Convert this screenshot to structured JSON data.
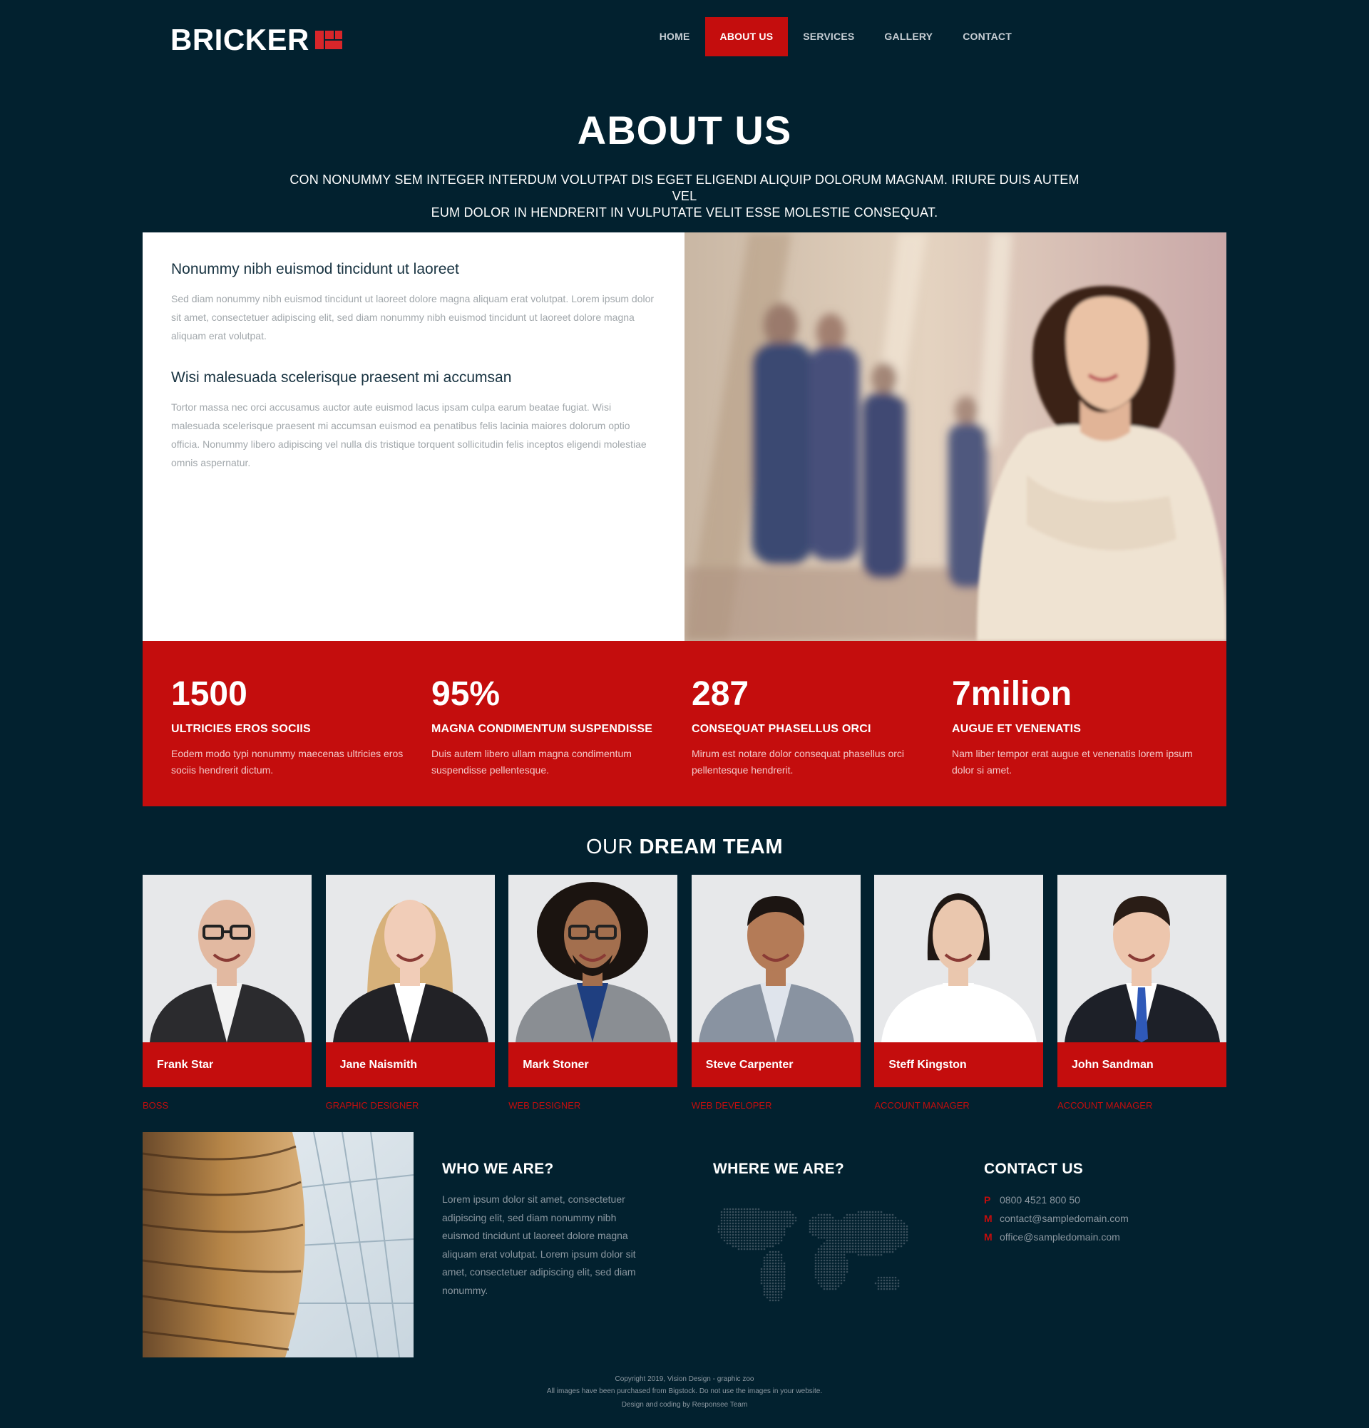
{
  "brand": {
    "name": "BRICKER",
    "accent": "#c40d0d",
    "background": "#02212f"
  },
  "nav": {
    "items": [
      {
        "label": "HOME"
      },
      {
        "label": "ABOUT US",
        "active": true
      },
      {
        "label": "SERVICES"
      },
      {
        "label": "GALLERY"
      },
      {
        "label": "CONTACT"
      }
    ]
  },
  "hero": {
    "title": "ABOUT US",
    "subtitle_line1": "CON NONUMMY SEM INTEGER INTERDUM VOLUTPAT DIS EGET ELIGENDI ALIQUIP DOLORUM MAGNAM. IRIURE DUIS AUTEM VEL",
    "subtitle_line2": "EUM DOLOR IN HENDRERIT IN VULPUTATE VELIT ESSE MOLESTIE CONSEQUAT."
  },
  "intro": {
    "heading1": "Nonummy nibh euismod tincidunt ut laoreet",
    "text1": "Sed diam nonummy nibh euismod tincidunt ut laoreet dolore magna aliquam erat volutpat. Lorem ipsum dolor sit amet, consectetuer adipiscing elit, sed diam nonummy nibh euismod tincidunt ut laoreet dolore magna aliquam erat volutpat.",
    "heading2": "Wisi malesuada scelerisque praesent mi accumsan",
    "text2": "Tortor massa nec orci accusamus auctor aute euismod lacus ipsam culpa earum beatae fugiat. Wisi malesuada scelerisque praesent mi accumsan euismod ea penatibus felis lacinia maiores dolorum optio officia. Nonummy libero adipiscing vel nulla dis tristique torquent sollicitudin felis inceptos eligendi molestiae omnis aspernatur."
  },
  "stats": [
    {
      "value": "1500",
      "label": "ULTRICIES EROS SOCIIS",
      "desc": "Eodem modo typi nonummy maecenas ultricies eros sociis hendrerit dictum."
    },
    {
      "value": "95%",
      "label": "MAGNA CONDIMENTUM SUSPENDISSE",
      "desc": "Duis autem libero ullam magna condimentum suspendisse pellentesque."
    },
    {
      "value": "287",
      "label": "CONSEQUAT PHASELLUS ORCI",
      "desc": "Mirum est notare dolor consequat phasellus orci pellentesque hendrerit."
    },
    {
      "value": "7milion",
      "label": "AUGUE ET VENENATIS",
      "desc": "Nam liber tempor erat augue et venenatis lorem ipsum dolor si amet."
    }
  ],
  "team": {
    "title_light": "OUR",
    "title_bold": "DREAM TEAM",
    "members": [
      {
        "name": "Frank Star",
        "role": "BOSS",
        "skin": "#e2b9a1",
        "hair": "#c9a28c",
        "suit": "#2b2b2e",
        "shirt": "#f2f2f2"
      },
      {
        "name": "Jane Naismith",
        "role": "GRAPHIC DESIGNER",
        "skin": "#f1cdb8",
        "hair": "#d7b17a",
        "suit": "#222226",
        "shirt": "#ffffff"
      },
      {
        "name": "Mark Stoner",
        "role": "WEB DESIGNER",
        "skin": "#a36f4e",
        "hair": "#1b1410",
        "suit": "#8a8e93",
        "shirt": "#1f3f80"
      },
      {
        "name": "Steve Carpenter",
        "role": "WEB DEVELOPER",
        "skin": "#b47b57",
        "hair": "#1c1512",
        "suit": "#8993a1",
        "shirt": "#dfe4ec"
      },
      {
        "name": "Steff Kingston",
        "role": "ACCOUNT MANAGER",
        "skin": "#eac7ae",
        "hair": "#201814",
        "suit": "#ffffff",
        "shirt": "#ffffff"
      },
      {
        "name": "John Sandman",
        "role": "ACCOUNT MANAGER",
        "skin": "#edc6ad",
        "hair": "#2a1d16",
        "suit": "#1d2028",
        "shirt": "#ffffff"
      }
    ]
  },
  "who": {
    "title": "WHO WE ARE?",
    "text": "Lorem ipsum dolor sit amet, consectetuer adipiscing elit, sed diam nonummy nibh euismod tincidunt ut laoreet dolore magna aliquam erat volutpat. Lorem ipsum dolor sit amet, consectetuer adipiscing elit, sed diam nonummy."
  },
  "where": {
    "title": "WHERE WE ARE?"
  },
  "contact": {
    "title": "CONTACT US",
    "lines": [
      {
        "key": "P",
        "value": "0800 4521 800 50"
      },
      {
        "key": "M",
        "value": "contact@sampledomain.com"
      },
      {
        "key": "M",
        "value": "office@sampledomain.com"
      }
    ]
  },
  "footer": {
    "line1": "Copyright 2019, Vision Design - graphic zoo",
    "line2": "All images have been purchased from Bigstock. Do not use the images in your website.",
    "line3": "Design and coding by Responsee Team"
  }
}
